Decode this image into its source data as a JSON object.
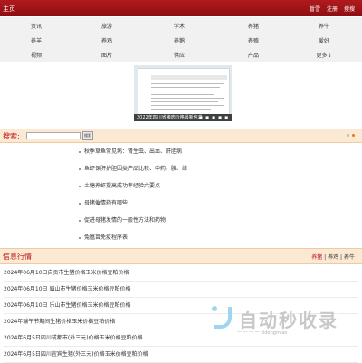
{
  "header": {
    "home": "主页",
    "links": [
      "暂雪",
      "注册",
      "搜搜"
    ]
  },
  "nav": {
    "rows": [
      [
        "资讯",
        "旅游",
        "学术",
        "养猪",
        "养牛"
      ],
      [
        "养羊",
        "养鸡",
        "养鹅",
        "养殖",
        "爱好"
      ],
      [
        "视频",
        "图片",
        "供应",
        "产品",
        "更多↓"
      ]
    ]
  },
  "banner": {
    "caption": "2022年四川省猪肉价格最新信息",
    "dots": "■ ■ ■ ■ ■"
  },
  "search": {
    "label": "搜索:",
    "value": "",
    "button": "搜索"
  },
  "articles": [
    "秋季草鱼常见病：肾生虫、出血、肝胆病",
    "鱼虾保肝护胆因类产品比较、中药、胰、维",
    "土塘养虾提高成功率经验六要点",
    "母猪催情药有哪些",
    "促进母猪发情的一般性方法和药物",
    "兔瘟苗免疫程序表"
  ],
  "info": {
    "title": "信息行情",
    "tabs": [
      {
        "label": "养猪",
        "active": true
      },
      {
        "label": "养鸡",
        "active": false
      },
      {
        "label": "养牛",
        "active": false
      }
    ],
    "separator": "|",
    "items": [
      "2024年06月10日自贡市生猪价格玉米价格豆粕价格",
      "2024年06月10日 眉山市生猪价格玉米价格豆粕价格",
      "2024年06月10日 乐山市生猪价格玉米价格豆粕价格",
      "2024年端午节期间生猪价格玉米价格豆粕价格",
      "2024年6月5日四川成都市(外三元)价格玉米价格豆粕价格",
      "2024年6月5日四川宜宾生猪(外三元)价格玉米价格豆粕价格"
    ]
  },
  "watermark": {
    "text": "自动秒收录",
    "sub": "一 一 一 一 zidongmiao"
  },
  "colors": {
    "topbar": "#a01418",
    "accent": "#c2191d",
    "bar_bg": "#fbe9d4",
    "dot_gray": "#bbbbbb",
    "dot_orange": "#e07a1c"
  }
}
